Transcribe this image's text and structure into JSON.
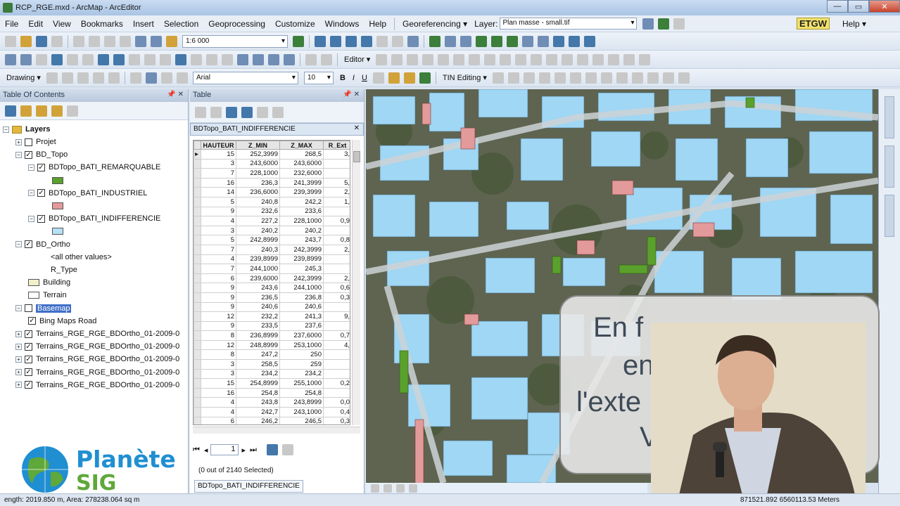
{
  "window": {
    "title": "RCP_RGE.mxd - ArcMap - ArcEditor",
    "min": "—",
    "max": "▭",
    "close": "✕"
  },
  "menu": [
    "File",
    "Edit",
    "View",
    "Bookmarks",
    "Insert",
    "Selection",
    "Geoprocessing",
    "Customize",
    "Windows",
    "Help"
  ],
  "georef": {
    "label": "Georeferencing ▾",
    "layer_label": "Layer:",
    "layer_value": "Plan masse - small.tif"
  },
  "etgw": "ETGW",
  "help_menu": "Help ▾",
  "toolbar1": {
    "scale": "1:6 000"
  },
  "toolbar2": {
    "editor": "Editor ▾"
  },
  "toolbar3": {
    "drawing": "Drawing ▾",
    "font": "Arial",
    "size": "10",
    "bold": "B",
    "italic": "I",
    "underline": "U",
    "tin": "TIN Editing ▾"
  },
  "toc": {
    "title": "Table Of Contents",
    "pin": "📌 ✕",
    "layers_root": "Layers",
    "items": [
      {
        "label": "Projet",
        "level": 1,
        "expand": "+",
        "checked": false
      },
      {
        "label": "BD_Topo",
        "level": 1,
        "expand": "−",
        "checked": true
      },
      {
        "label": "BDTopo_BATI_REMARQUABLE",
        "level": 2,
        "expand": "−",
        "checked": true,
        "swatch": "#5aa02c"
      },
      {
        "label": "BDTopo_BATI_INDUSTRIEL",
        "level": 2,
        "expand": "−",
        "checked": true,
        "swatch": "#e39a9a"
      },
      {
        "label": "BDTopo_BATI_INDIFFERENCIE",
        "level": 2,
        "expand": "−",
        "checked": true,
        "swatch": "#b6e0f5"
      },
      {
        "label": "BD_Ortho",
        "level": 1,
        "expand": "−",
        "checked": true
      },
      {
        "label": "<all other values>",
        "level": 3
      },
      {
        "label": "R_Type",
        "level": 3
      },
      {
        "label": "Building",
        "level": 2,
        "swatch": "#f1f0c9"
      },
      {
        "label": "Terrain",
        "level": 2,
        "swatch": "#ffffff"
      },
      {
        "label": "Basemap",
        "level": 1,
        "expand": "−",
        "checked": false,
        "selected": true
      },
      {
        "label": "Bing Maps Road",
        "level": 2,
        "checked": true
      },
      {
        "label": "Terrains_RGE_RGE_BDOrtho_01-2009-0",
        "level": 1,
        "expand": "+",
        "checked": true
      },
      {
        "label": "Terrains_RGE_RGE_BDOrtho_01-2009-0",
        "level": 1,
        "expand": "+",
        "checked": true
      },
      {
        "label": "Terrains_RGE_RGE_BDOrtho_01-2009-0",
        "level": 1,
        "expand": "+",
        "checked": true
      },
      {
        "label": "Terrains_RGE_RGE_BDOrtho_01-2009-0",
        "level": 1,
        "expand": "+",
        "checked": true
      },
      {
        "label": "Terrains_RGE_RGE_BDOrtho_01-2009-0",
        "level": 1,
        "expand": "+",
        "checked": true
      }
    ]
  },
  "table": {
    "title": "Table",
    "pin": "📌 ✕",
    "tab_name": "BDTopo_BATI_INDIFFERENCIE",
    "close": "✕",
    "columns": [
      "",
      "HAUTEUR",
      "Z_MIN",
      "Z_MAX",
      "R_Ext"
    ],
    "rows": [
      [
        "▸",
        "15",
        "252,3999",
        "268,5",
        "3,"
      ],
      [
        "",
        "3",
        "243,6000",
        "243,6000",
        ""
      ],
      [
        "",
        "7",
        "228,1000",
        "232,6000",
        ""
      ],
      [
        "",
        "16",
        "236,3",
        "241,3999",
        "5,"
      ],
      [
        "",
        "14",
        "236,6000",
        "239,3999",
        "2,"
      ],
      [
        "",
        "5",
        "240,8",
        "242,2",
        "1,"
      ],
      [
        "",
        "9",
        "232,6",
        "233,6",
        ""
      ],
      [
        "",
        "4",
        "227,2",
        "228,1000",
        "0,9"
      ],
      [
        "",
        "3",
        "240,2",
        "240,2",
        ""
      ],
      [
        "",
        "5",
        "242,8999",
        "243,7",
        "0,8"
      ],
      [
        "",
        "7",
        "240,3",
        "242,3999",
        "2,"
      ],
      [
        "",
        "4",
        "239,8999",
        "239,8999",
        ""
      ],
      [
        "",
        "7",
        "244,1000",
        "245,3",
        ""
      ],
      [
        "",
        "6",
        "239,6000",
        "242,3999",
        "2,"
      ],
      [
        "",
        "9",
        "243,6",
        "244,1000",
        "0,6"
      ],
      [
        "",
        "9",
        "236,5",
        "236,8",
        "0,3"
      ],
      [
        "",
        "9",
        "240,6",
        "240,6",
        ""
      ],
      [
        "",
        "12",
        "232,2",
        "241,3",
        "9,"
      ],
      [
        "",
        "9",
        "233,5",
        "237,6",
        ""
      ],
      [
        "",
        "8",
        "236,8999",
        "237,6000",
        "0,7"
      ],
      [
        "",
        "12",
        "248,8999",
        "253,1000",
        "4,"
      ],
      [
        "",
        "8",
        "247,2",
        "250",
        ""
      ],
      [
        "",
        "3",
        "258,5",
        "259",
        ""
      ],
      [
        "",
        "3",
        "234,2",
        "234,2",
        ""
      ],
      [
        "",
        "15",
        "254,8999",
        "255,1000",
        "0,2"
      ],
      [
        "",
        "16",
        "254,8",
        "254,8",
        ""
      ],
      [
        "",
        "4",
        "243,8",
        "243,8999",
        "0,0"
      ],
      [
        "",
        "4",
        "242,7",
        "243,1000",
        "0,4"
      ],
      [
        "",
        "6",
        "246,2",
        "246,5",
        "0,3"
      ],
      [
        "",
        "5",
        "244,6000",
        "245,6000",
        ""
      ]
    ],
    "record": "1",
    "selected_status": "(0 out of 2140 Selected)",
    "bottom_tab": "BDTopo_BATI_INDIFFERENCIE"
  },
  "slide": {
    "line1": "En  f ...",
    "line2": "en",
    "line3": "l'exte",
    "line4": "V"
  },
  "logo": {
    "line1": "Planète",
    "line2": "SIG"
  },
  "status": {
    "left": "ength: 2019.850 m, Area: 278238.064 sq m",
    "coords": "871521.892  6560113.53 Meters"
  },
  "colors": {
    "building_blue": "#9fd7f5",
    "industrial": "#e39a9a",
    "remarquable": "#5aa02c"
  }
}
